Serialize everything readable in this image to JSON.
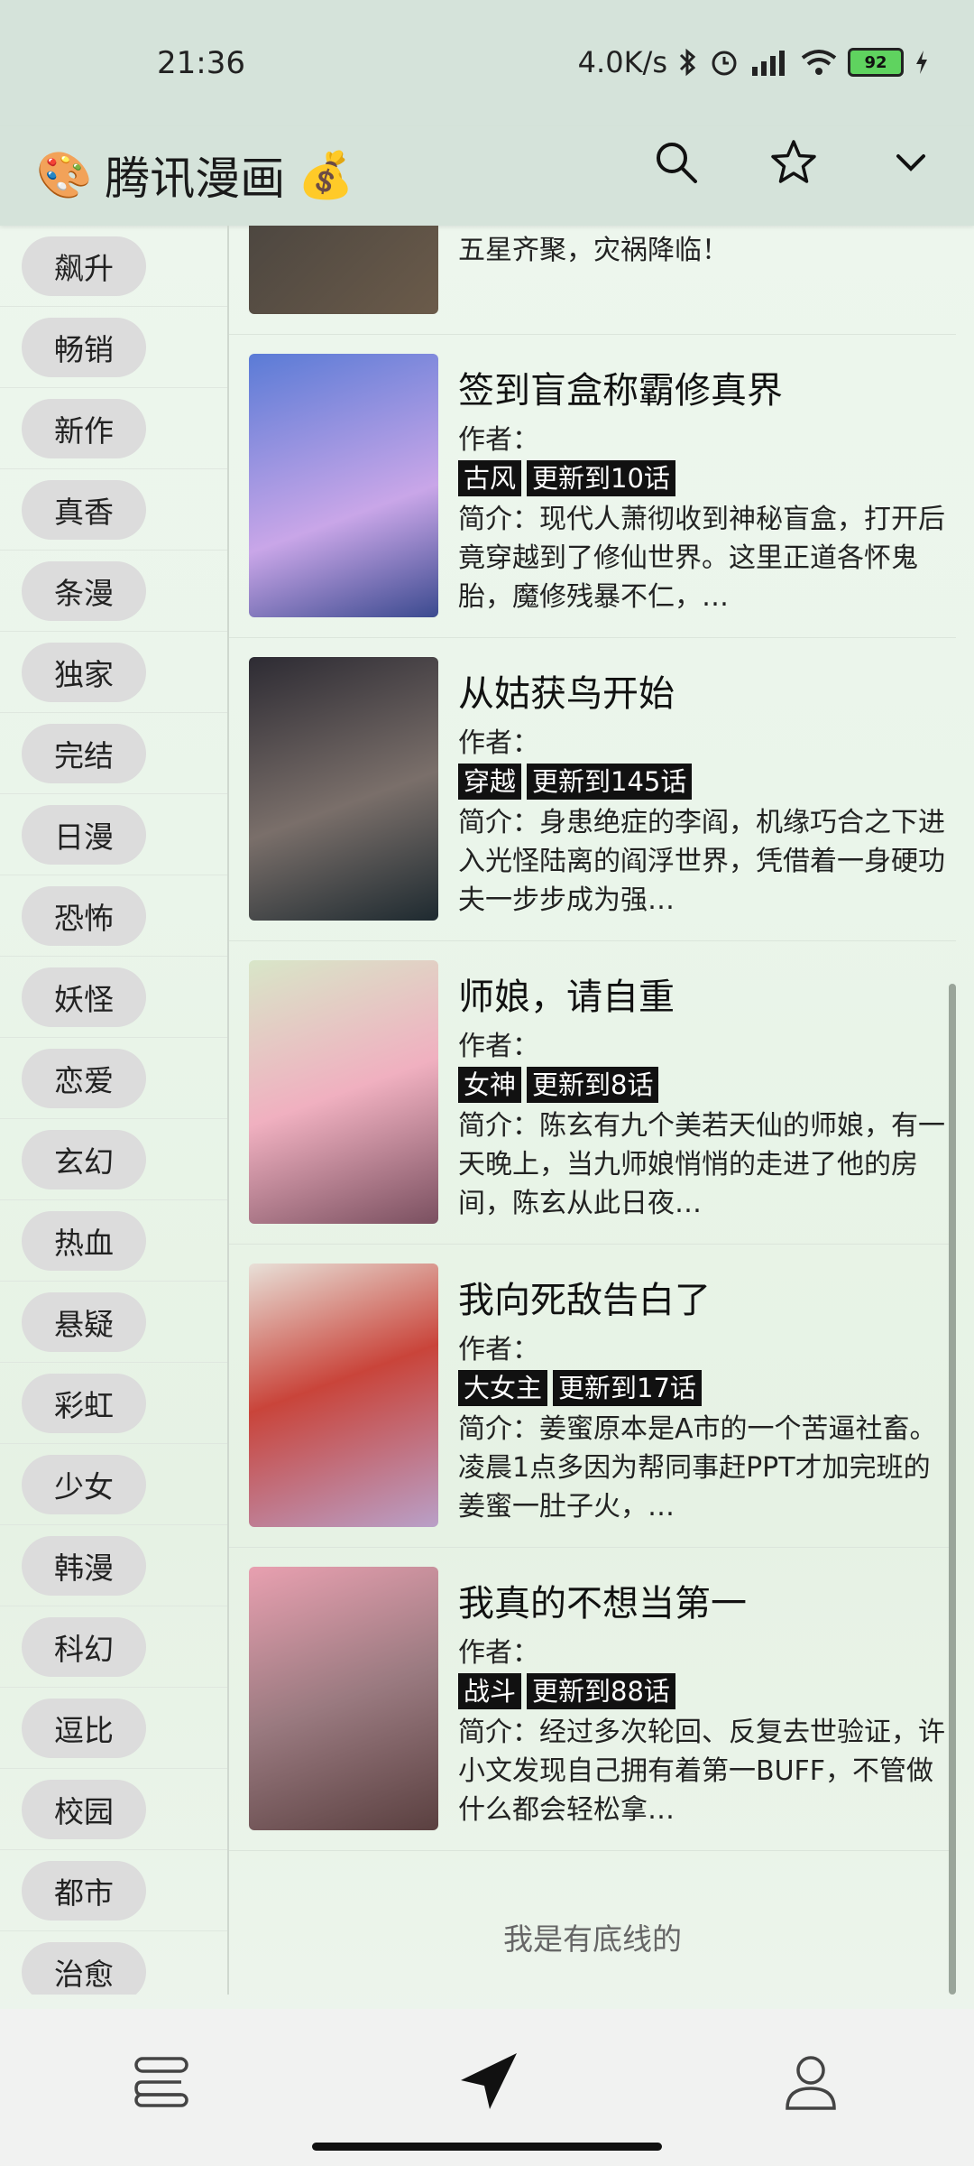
{
  "status_bar": {
    "time": "21:36",
    "speed": "4.0K/s",
    "battery": "92"
  },
  "app_bar": {
    "palette": "🎨",
    "title": "腾讯漫画",
    "money": "💰"
  },
  "sidebar": {
    "items": [
      "飙升",
      "畅销",
      "新作",
      "真香",
      "条漫",
      "独家",
      "完结",
      "日漫",
      "恐怖",
      "妖怪",
      "恋爱",
      "玄幻",
      "热血",
      "悬疑",
      "彩虹",
      "少女",
      "韩漫",
      "科幻",
      "逗比",
      "校园",
      "都市",
      "治愈"
    ]
  },
  "comics": [
    {
      "title": "",
      "author": "",
      "tags": [],
      "intro": "五星齐聚，灾祸降临！",
      "cover_colors": [
        "#3a3a3a",
        "#6b5b4a"
      ]
    },
    {
      "title": "签到盲盒称霸修真界",
      "author": "作者：",
      "tags": [
        "古风",
        "更新到10话"
      ],
      "intro": "简介：现代人萧彻收到神秘盲盒，打开后竟穿越到了修仙世界。这里正道各怀鬼胎，魔修残暴不仁，…",
      "cover_colors": [
        "#5a7bd6",
        "#c9a6e8"
      ]
    },
    {
      "title": "从姑获鸟开始",
      "author": "作者：",
      "tags": [
        "穿越",
        "更新到145话"
      ],
      "intro": "简介：身患绝症的李阎，机缘巧合之下进入光怪陆离的阎浮世界，凭借着一身硬功夫一步步成为强…",
      "cover_colors": [
        "#2d2b33",
        "#7a6f6a"
      ]
    },
    {
      "title": "师娘，请自重",
      "author": "作者：",
      "tags": [
        "女神",
        "更新到8话"
      ],
      "intro": "简介：陈玄有九个美若天仙的师娘，有一天晚上，当九师娘悄悄的走进了他的房间，陈玄从此日夜…",
      "cover_colors": [
        "#f0b0c0",
        "#d8e6c8"
      ]
    },
    {
      "title": "我向死敌告白了",
      "author": "作者：",
      "tags": [
        "大女主",
        "更新到17话"
      ],
      "intro": "简介：姜蜜原本是A市的一个苦逼社畜。凌晨1点多因为帮同事赶PPT才加完班的姜蜜一肚子火，…",
      "cover_colors": [
        "#c9443a",
        "#b9a0c8"
      ]
    },
    {
      "title": "我真的不想当第一",
      "author": "作者：",
      "tags": [
        "战斗",
        "更新到88话"
      ],
      "intro": "简介：经过多次轮回、反复去世验证，许小文发现自己拥有着第一BUFF，不管做什么都会轻松拿…",
      "cover_colors": [
        "#e8a0b0",
        "#5a4040"
      ]
    }
  ],
  "footer": {
    "text": "我是有底线的"
  }
}
